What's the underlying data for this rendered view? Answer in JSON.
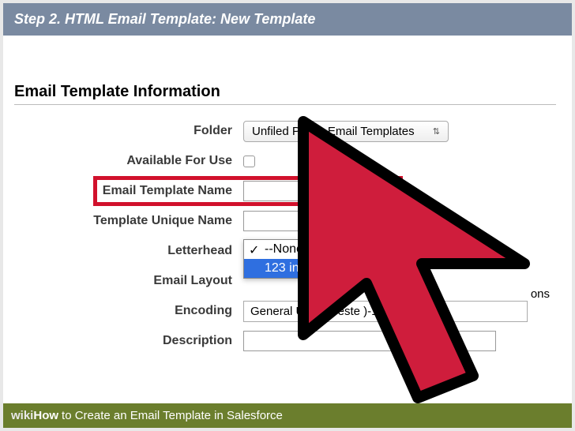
{
  "header": {
    "title": "Step 2. HTML Email Template: New Template"
  },
  "section": {
    "title": "Email Template Information"
  },
  "labels": {
    "folder": "Folder",
    "available": "Available For Use",
    "template_name": "Email Template Name",
    "unique_name": "Template Unique Name",
    "letterhead": "Letterhead",
    "email_layout": "Email Layout",
    "encoding": "Encoding",
    "description": "Description"
  },
  "fields": {
    "folder_selected": "Unfiled Public Email Templates",
    "template_name_value": "",
    "unique_name_value": "",
    "encoding_value_visible": "General US & Weste                                            )-1, ISO-LATI",
    "description_value": ""
  },
  "letterhead_dropdown": {
    "options": [
      "--None--",
      "123 inc"
    ],
    "checked": "--None--",
    "highlighted": "123 inc"
  },
  "residual": {
    "suffix": "ons"
  },
  "footer": {
    "prefix1": "wiki",
    "prefix2": "How",
    "title": "to Create an Email Template in Salesforce"
  }
}
